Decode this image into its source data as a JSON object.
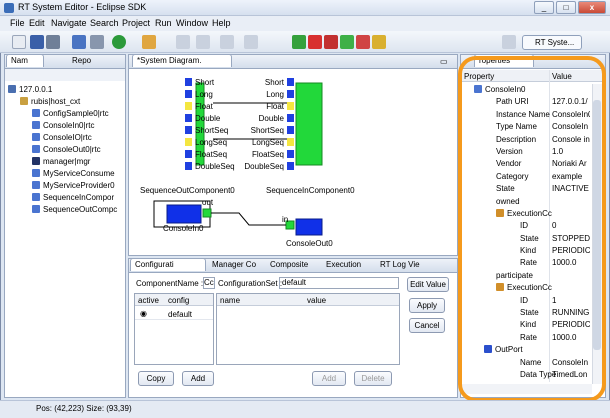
{
  "window": {
    "title": "RT System Editor - Eclipse SDK",
    "min": "_",
    "max": "□",
    "close": "x"
  },
  "menu": [
    "File",
    "Edit",
    "Navigate",
    "Search",
    "Project",
    "Run",
    "Window",
    "Help"
  ],
  "perspective": {
    "label": "RT Syste..."
  },
  "left_panel": {
    "tabs": [
      "Nam",
      "Repo"
    ],
    "tree": [
      {
        "label": "127.0.0.1",
        "depth": 0,
        "icon": "host-icon"
      },
      {
        "label": "rubis|host_cxt",
        "depth": 1,
        "icon": "context-icon"
      },
      {
        "label": "ConfigSample0|rtc",
        "depth": 2,
        "icon": "rtc-icon"
      },
      {
        "label": "ConsoleIn0|rtc",
        "depth": 2,
        "icon": "rtc-icon"
      },
      {
        "label": "ConsoleIO|rtc",
        "depth": 2,
        "icon": "rtc-icon"
      },
      {
        "label": "ConsoleOut0|rtc",
        "depth": 2,
        "icon": "rtc-icon"
      },
      {
        "label": "manager|mgr",
        "depth": 2,
        "icon": "manager-icon"
      },
      {
        "label": "MyServiceConsume",
        "depth": 2,
        "icon": "rtc-icon"
      },
      {
        "label": "MyServiceProvider0",
        "depth": 2,
        "icon": "rtc-icon"
      },
      {
        "label": "SequenceInCompor",
        "depth": 2,
        "icon": "rtc-icon"
      },
      {
        "label": "SequenceOutCompc",
        "depth": 2,
        "icon": "rtc-icon"
      }
    ]
  },
  "diagram": {
    "tab": "*System Diagram.",
    "seq_out": {
      "name": "SequenceOutComponent0",
      "ports": [
        "Short",
        "Long",
        "Float",
        "Double",
        "ShortSeq",
        "LongSeq",
        "FloatSeq",
        "DoubleSeq"
      ]
    },
    "seq_in": {
      "name": "SequenceInComponent0",
      "ports": [
        "Short",
        "Long",
        "Float",
        "Double",
        "ShortSeq",
        "LongSeq",
        "FloatSeq",
        "DoubleSeq"
      ]
    },
    "console_in": {
      "name": "ConsoleIn0",
      "port": "out"
    },
    "console_out": {
      "name": "ConsoleOut0",
      "port": "in"
    }
  },
  "bottom_panel": {
    "tabs": [
      "Configurati",
      "Manager Co",
      "Composite",
      "Execution",
      "RT Log Vie"
    ],
    "component_name_label": "ComponentName :",
    "component_name_value": "Cc",
    "config_set_label": "ConfigurationSet :",
    "config_set_value": "default",
    "edit_value": "Edit Value",
    "apply": "Apply",
    "cancel": "Cancel",
    "left_table": {
      "headers": [
        "active",
        "config"
      ],
      "rows": [
        {
          "active": true,
          "config": "default"
        }
      ]
    },
    "right_table": {
      "headers": [
        "name",
        "value"
      ]
    },
    "copy": "Copy",
    "add_left": "Add",
    "add_right": "Add",
    "delete": "Delete"
  },
  "properties": {
    "tab": "roperties",
    "headers": [
      "Property",
      "Value"
    ],
    "rows": [
      {
        "p": "ConsoleIn0",
        "v": "",
        "depth": 1,
        "icon": "rtc-icon"
      },
      {
        "p": "Path URI",
        "v": "127.0.0.1/",
        "depth": 2
      },
      {
        "p": "Instance Name",
        "v": "ConsoleIn0",
        "depth": 2
      },
      {
        "p": "Type Name",
        "v": "ConsoleIn",
        "depth": 2
      },
      {
        "p": "Description",
        "v": "Console in",
        "depth": 2
      },
      {
        "p": "Version",
        "v": "1.0",
        "depth": 2
      },
      {
        "p": "Vendor",
        "v": "Noriaki Ar",
        "depth": 2
      },
      {
        "p": "Category",
        "v": "example",
        "depth": 2
      },
      {
        "p": "State",
        "v": "INACTIVE",
        "depth": 2
      },
      {
        "p": "owned",
        "v": "",
        "depth": 2
      },
      {
        "p": "ExecutionCc",
        "v": "",
        "depth": 3,
        "icon": "ec-icon"
      },
      {
        "p": "ID",
        "v": "0",
        "depth": 4
      },
      {
        "p": "State",
        "v": "STOPPED",
        "depth": 4
      },
      {
        "p": "Kind",
        "v": "PERIODIC",
        "depth": 4
      },
      {
        "p": "Rate",
        "v": "1000.0",
        "depth": 4
      },
      {
        "p": "participate",
        "v": "",
        "depth": 2
      },
      {
        "p": "ExecutionCc",
        "v": "",
        "depth": 3,
        "icon": "ec-icon"
      },
      {
        "p": "ID",
        "v": "1",
        "depth": 4
      },
      {
        "p": "State",
        "v": "RUNNING",
        "depth": 4
      },
      {
        "p": "Kind",
        "v": "PERIODIC",
        "depth": 4
      },
      {
        "p": "Rate",
        "v": "1000.0",
        "depth": 4
      },
      {
        "p": "OutPort",
        "v": "",
        "depth": 2,
        "icon": "outport-icon"
      },
      {
        "p": "Name",
        "v": "ConsoleIn",
        "depth": 4
      },
      {
        "p": "Data Type",
        "v": "TimedLon",
        "depth": 4
      }
    ]
  },
  "status": {
    "text": "Pos: (42,223) Size: (93,39)"
  },
  "colors": {
    "highlight": "#f59a1c",
    "component_green": "#22d83a",
    "component_blue": "#1030e8",
    "port_blue": "#2040e0"
  }
}
